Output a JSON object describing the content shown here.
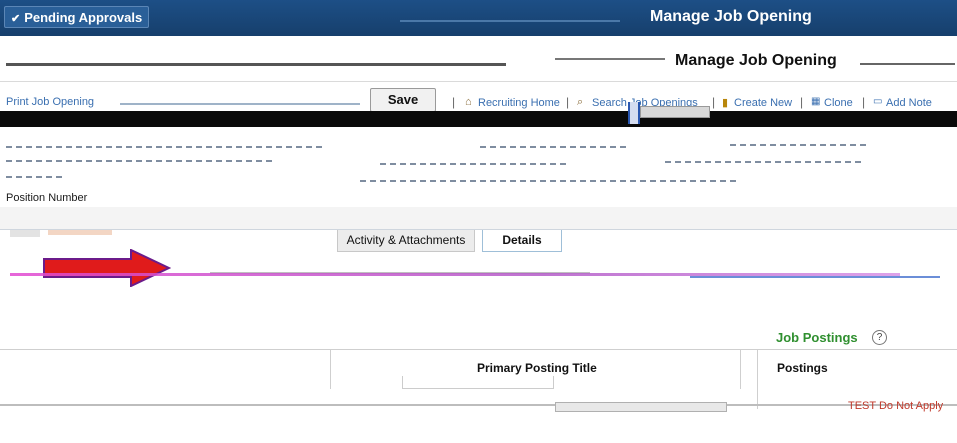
{
  "header": {
    "pending_label": "Pending Approvals",
    "title": "Manage Job Opening"
  },
  "page": {
    "title": "Manage Job Opening"
  },
  "toolbar": {
    "print_label": "Print Job Opening",
    "save_label": "Save",
    "links": [
      "Recruiting Home",
      "Search Job Openings",
      "Create New",
      "Clone",
      "Add Note"
    ]
  },
  "fields": {
    "position_number": "Position Number"
  },
  "tabs": {
    "activity": "Activity & Attachments",
    "details": "Details"
  },
  "job_postings": {
    "title": "Job Postings",
    "help_icon": "?",
    "columns": [
      "Primary Posting Title",
      "Postings"
    ],
    "row_right": "TEST Do Not Apply"
  },
  "colors": {
    "topbar": "#1d4f86",
    "arrow": "#e01b1b",
    "job_postings_title": "#2f8f2f",
    "link": "#3a6fb0"
  }
}
